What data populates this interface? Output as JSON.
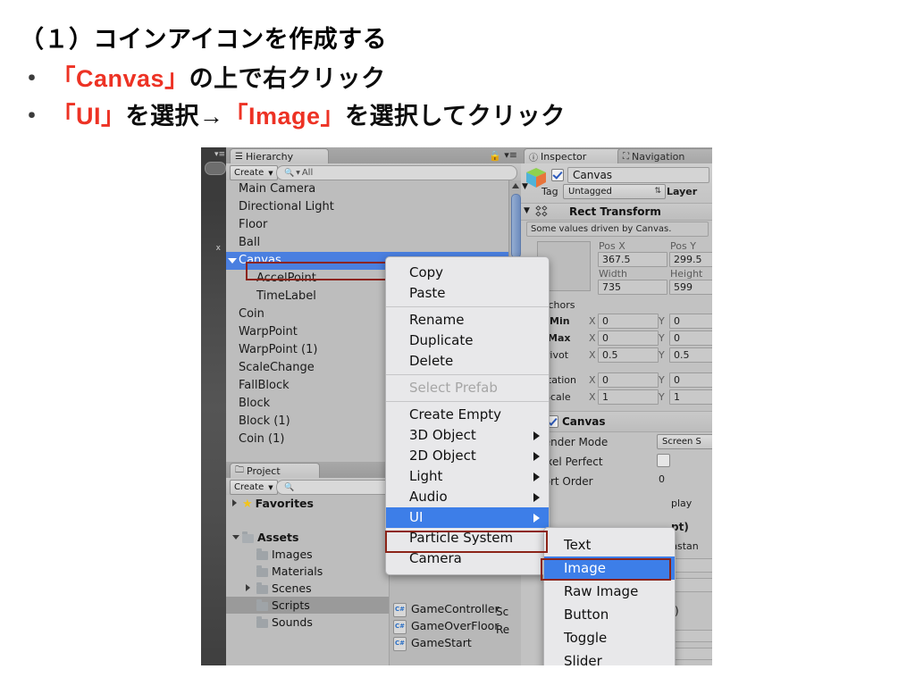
{
  "slide": {
    "title": "（１）コインアイコンを作成する",
    "bullets": [
      {
        "mark": "・",
        "parts": [
          {
            "text": "「Canvas」",
            "color": "red"
          },
          {
            "text": "の上で右クリック",
            "color": "black"
          }
        ]
      },
      {
        "mark": "・",
        "parts": [
          {
            "text": "「UI」",
            "color": "red"
          },
          {
            "text": "を選択→",
            "color": "black"
          },
          {
            "text": "「Image」",
            "color": "red"
          },
          {
            "text": "を選択してクリック",
            "color": "black"
          }
        ]
      }
    ],
    "line1": "（１）コインアイコンを作成する",
    "line2_bullet": "・",
    "line2_red": "「Canvas」",
    "line2_black": "の上で右クリック",
    "line3_bullet": "・",
    "line3_red1": "「UI」",
    "line3_black1": "を選択→",
    "line3_red2": "「Image」",
    "line3_black2": "を選択してクリック"
  },
  "colors": {
    "accent_red": "#ed3224",
    "selection_blue": "#4a7fe0",
    "menu_highlight": "#3d7ee8",
    "annotation_red_box": "#8c2418",
    "panel_gray": "#bdbdbd"
  },
  "hierarchy": {
    "tab_label": "Hierarchy",
    "tab_icon": "hierarchy-icon",
    "create_label": "Create",
    "search_placeholder": "All",
    "search_icon": "search-icon",
    "lock_icon": "lock-icon",
    "menu_icon": "panel-menu-icon",
    "items": [
      {
        "label": "Main Camera",
        "indent": 0,
        "selected": false,
        "expander": ""
      },
      {
        "label": "Directional Light",
        "indent": 0,
        "selected": false,
        "expander": ""
      },
      {
        "label": "Floor",
        "indent": 0,
        "selected": false,
        "expander": ""
      },
      {
        "label": "Ball",
        "indent": 0,
        "selected": false,
        "expander": ""
      },
      {
        "label": "Canvas",
        "indent": 0,
        "selected": true,
        "expander": "down"
      },
      {
        "label": "AccelPoint",
        "indent": 1,
        "selected": false,
        "expander": ""
      },
      {
        "label": "TimeLabel",
        "indent": 1,
        "selected": false,
        "expander": ""
      },
      {
        "label": "Coin",
        "indent": 0,
        "selected": false,
        "expander": ""
      },
      {
        "label": "WarpPoint",
        "indent": 0,
        "selected": false,
        "expander": ""
      },
      {
        "label": "WarpPoint (1)",
        "indent": 0,
        "selected": false,
        "expander": ""
      },
      {
        "label": "ScaleChange",
        "indent": 0,
        "selected": false,
        "expander": ""
      },
      {
        "label": "FallBlock",
        "indent": 0,
        "selected": false,
        "expander": ""
      },
      {
        "label": "Block",
        "indent": 0,
        "selected": false,
        "expander": ""
      },
      {
        "label": "Block (1)",
        "indent": 0,
        "selected": false,
        "expander": ""
      },
      {
        "label": "Coin (1)",
        "indent": 0,
        "selected": false,
        "expander": ""
      }
    ]
  },
  "context_menu": {
    "items": [
      {
        "label": "Copy",
        "type": "item"
      },
      {
        "label": "Paste",
        "type": "item"
      },
      {
        "label": "",
        "type": "separator"
      },
      {
        "label": "Rename",
        "type": "item"
      },
      {
        "label": "Duplicate",
        "type": "item"
      },
      {
        "label": "Delete",
        "type": "item"
      },
      {
        "label": "",
        "type": "separator"
      },
      {
        "label": "Select Prefab",
        "type": "disabled"
      },
      {
        "label": "",
        "type": "separator"
      },
      {
        "label": "Create Empty",
        "type": "item"
      },
      {
        "label": "3D Object",
        "type": "submenu"
      },
      {
        "label": "2D Object",
        "type": "submenu"
      },
      {
        "label": "Light",
        "type": "submenu"
      },
      {
        "label": "Audio",
        "type": "submenu"
      },
      {
        "label": "UI",
        "type": "submenu-highlighted"
      },
      {
        "label": "Particle System",
        "type": "item"
      },
      {
        "label": "Camera",
        "type": "item"
      }
    ]
  },
  "ui_submenu": {
    "items": [
      {
        "label": "Text",
        "highlighted": false
      },
      {
        "label": "Image",
        "highlighted": true
      },
      {
        "label": "Raw Image",
        "highlighted": false
      },
      {
        "label": "Button",
        "highlighted": false
      },
      {
        "label": "Toggle",
        "highlighted": false
      },
      {
        "label": "Slider",
        "highlighted": false
      }
    ]
  },
  "inspector": {
    "tab_label": "Inspector",
    "tab_icon": "info-icon",
    "tab2_label": "Navigation",
    "tab2_icon": "navigation-icon",
    "object_name": "Canvas",
    "object_enabled": true,
    "tag_label": "Tag",
    "tag_value": "Untagged",
    "layer_label": "Layer",
    "rect_transform": {
      "title": "Rect Transform",
      "info": "Some values driven by Canvas.",
      "pos_x_label": "Pos X",
      "pos_x": "367.5",
      "pos_y_label": "Pos Y",
      "pos_y": "299.5",
      "width_label": "Width",
      "width": "735",
      "height_label": "Height",
      "height": "599",
      "anchors_label": "Anchors",
      "min_label": "Min",
      "min_x": "0",
      "min_y": "0",
      "max_label": "Max",
      "max_x": "0",
      "max_y": "0",
      "pivot_label": "Pivot",
      "pivot_x": "0.5",
      "pivot_y": "0.5",
      "rotation_label": "Rotation",
      "rot_x": "0",
      "rot_y": "0",
      "scale_label": "Scale",
      "scale_x": "1",
      "scale_y": "1",
      "axis_x": "X",
      "axis_y": "Y"
    },
    "canvas_component": {
      "title": "Canvas",
      "enabled": true,
      "render_mode_label": "Render Mode",
      "render_mode_value": "Screen S",
      "pixel_perfect_label": "Pixel Perfect",
      "pixel_perfect": false,
      "sort_order_label": "Sort Order",
      "sort_order": "0",
      "target_display_value": "play",
      "script_suffix": "pt)",
      "instance_text": "nstan"
    }
  },
  "project": {
    "tab_label": "Project",
    "tab_icon": "folder-icon",
    "create_label": "Create",
    "search_icon": "search-icon",
    "search_placeholder": "",
    "assets_column_label": "As",
    "tree": [
      {
        "label": "Favorites",
        "icon": "star-icon",
        "indent": 0,
        "expander": "right",
        "selected": false,
        "bold": true
      },
      {
        "label": "",
        "icon": "",
        "indent": 0,
        "expander": "",
        "selected": false,
        "bold": false
      },
      {
        "label": "Assets",
        "icon": "folder-open-icon",
        "indent": 0,
        "expander": "down",
        "selected": false,
        "bold": true
      },
      {
        "label": "Images",
        "icon": "folder-icon",
        "indent": 1,
        "expander": "",
        "selected": false,
        "bold": false
      },
      {
        "label": "Materials",
        "icon": "folder-icon",
        "indent": 1,
        "expander": "",
        "selected": false,
        "bold": false
      },
      {
        "label": "Scenes",
        "icon": "folder-icon",
        "indent": 1,
        "expander": "right",
        "selected": false,
        "bold": false
      },
      {
        "label": "Scripts",
        "icon": "folder-icon",
        "indent": 1,
        "expander": "",
        "selected": true,
        "bold": false
      },
      {
        "label": "Sounds",
        "icon": "folder-icon",
        "indent": 1,
        "expander": "",
        "selected": false,
        "bold": false
      }
    ],
    "files": [
      {
        "label": "GameController",
        "icon": "csharp-script-icon"
      },
      {
        "label": "GameOverFloor",
        "icon": "csharp-script-icon"
      },
      {
        "label": "GameStart",
        "icon": "csharp-script-icon"
      }
    ],
    "preview_sc": "Sc",
    "preview_re": "Re"
  }
}
